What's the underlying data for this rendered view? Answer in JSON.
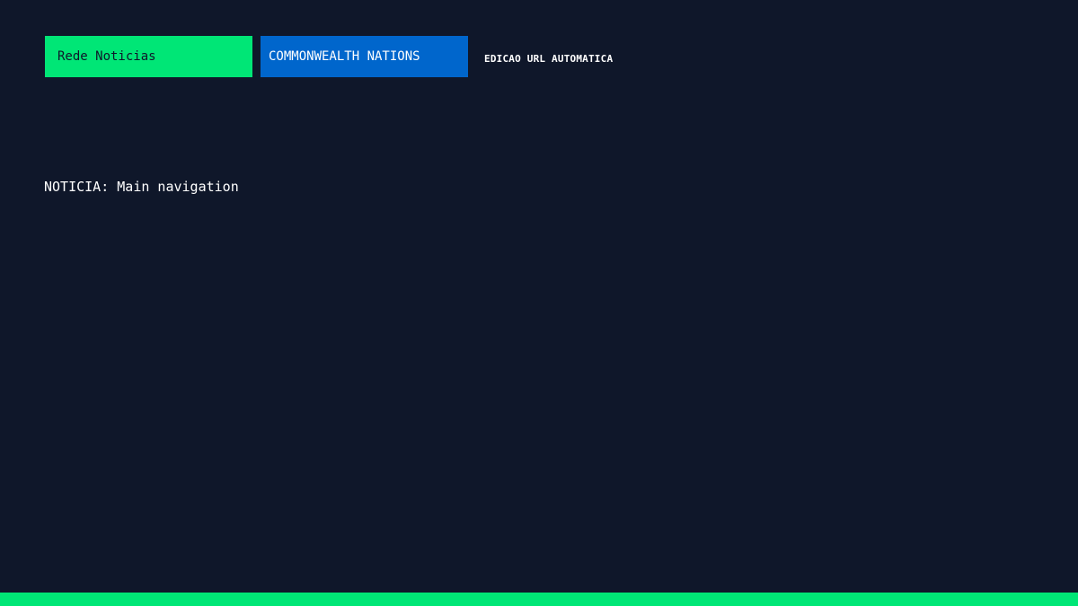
{
  "header": {
    "brand": "Rede Noticias",
    "nation": "COMMONWEALTH NATIONS",
    "edition": "EDICAO URL AUTOMATICA"
  },
  "main": {
    "headline": "NOTICIA: Main navigation"
  },
  "colors": {
    "background": "#0f172a",
    "brand_green": "#00e676",
    "nation_blue": "#0066cc",
    "text": "#ffffff"
  }
}
